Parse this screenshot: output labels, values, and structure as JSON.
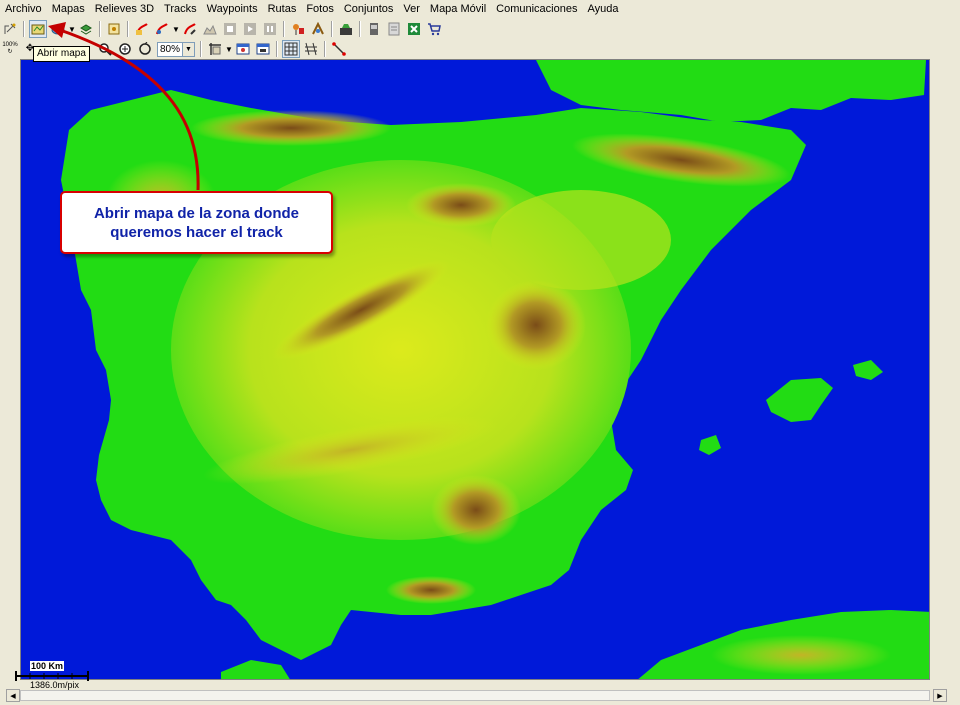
{
  "menu": {
    "items": [
      "Archivo",
      "Mapas",
      "Relieves 3D",
      "Tracks",
      "Waypoints",
      "Rutas",
      "Fotos",
      "Conjuntos",
      "Ver",
      "Mapa Móvil",
      "Comunicaciones",
      "Ayuda"
    ]
  },
  "toolbar": {
    "tooltip": "Abrir mapa",
    "zoom_value": "80%",
    "zoom_100_label": "100%"
  },
  "callout": {
    "line1": "Abrir mapa de la zona donde",
    "line2": "queremos hacer el track"
  },
  "scale": {
    "label": "100 Km",
    "resolution": "1386.0m/pix"
  },
  "colors": {
    "sea": "#0019d9",
    "lowland": "#22dc14",
    "midland": "#dcea1c",
    "highland": "#b29a24",
    "peak": "#7a4c18",
    "callout_border": "#d80000",
    "callout_text": "#1023a8",
    "arrow": "#c40000"
  }
}
